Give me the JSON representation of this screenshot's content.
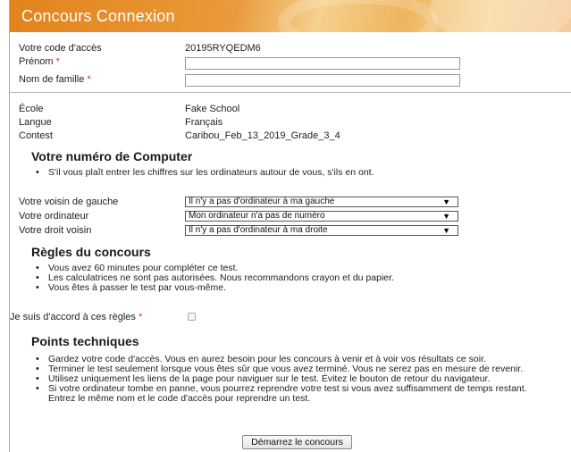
{
  "header": {
    "title": "Concours Connexion"
  },
  "login": {
    "access_code_label": "Votre code d'accès",
    "access_code_value": "20195RYQEDM6",
    "first_name_label": "Prénom",
    "last_name_label": "Nom de famille",
    "required_mark": "*"
  },
  "info": {
    "school_label": "École",
    "school_value": "Fake School",
    "language_label": "Langue",
    "language_value": "Français",
    "contest_label": "Contest",
    "contest_value": "Caribou_Feb_13_2019_Grade_3_4"
  },
  "computer_number": {
    "heading": "Votre numéro de Computer",
    "bullets": [
      "S'il vous plaît entrer les chiffres sur les ordinateurs autour de vous, s'ils en ont."
    ],
    "left_label": "Votre voisin de gauche",
    "left_value": "Il n'y a pas d'ordinateur à ma gauche",
    "mine_label": "Votre ordinateur",
    "mine_value": "Mon ordinateur n'a pas de numéro",
    "right_label": "Votre droit voisin",
    "right_value": "Il n'y a pas d'ordinateur à ma droite"
  },
  "rules": {
    "heading": "Règles du concours",
    "bullets": [
      "Vous avez 60 minutes pour compléter ce test.",
      "Les calculatrices ne sont pas autorisées. Nous recommandons crayon et du papier.",
      "Vous êtes à passer le test par vous-même."
    ],
    "agree_label": "Je suis d'accord à ces règles",
    "agree_checked": false
  },
  "technical": {
    "heading": "Points techniques",
    "bullets": [
      "Gardez votre code d'accès. Vous en aurez besoin pour les concours à venir et à voir vos résultats ce soir.",
      "Terminer le test seulement lorsque vous êtes sûr que vous avez terminé. Vous ne serez pas en mesure de revenir.",
      "Utilisez uniquement les liens de la page pour naviguer sur le test. Évitez le bouton de retour du navigateur.",
      "Si votre ordinateur tombe en panne, vous pourrez reprendre votre test si vous avez suffisamment de temps restant. Entrez le même nom et le code d'accès pour reprendre un test."
    ]
  },
  "actions": {
    "start_label": "Démarrez le concours"
  },
  "colors": {
    "header_orange": "#e2831b",
    "required_red": "#e0301e"
  },
  "icons": {
    "dropdown": "dropdown-arrow-icon"
  }
}
